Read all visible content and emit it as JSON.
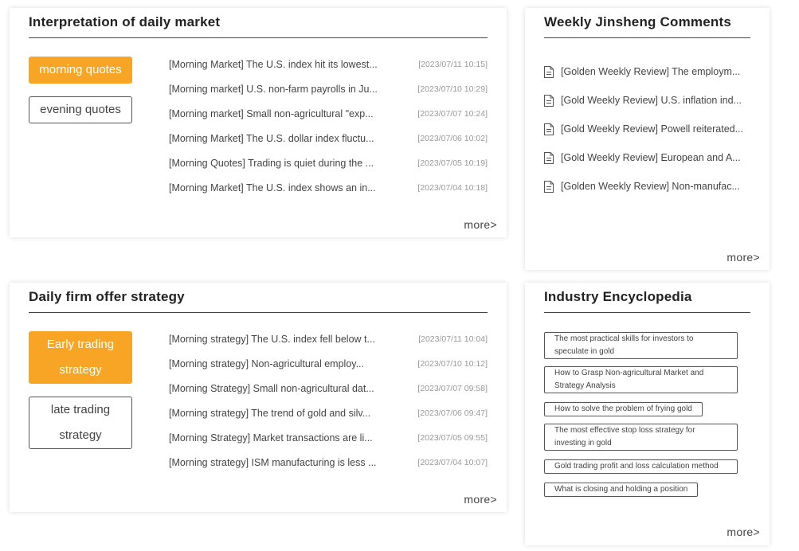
{
  "daily_market": {
    "title": "Interpretation of daily market",
    "tabs": [
      "morning quotes",
      "evening quotes"
    ],
    "items": [
      {
        "title": "[Morning Market] The U.S. index hit its lowest...",
        "date": "[2023/07/11 10:15]"
      },
      {
        "title": "[Morning market] U.S. non-farm payrolls in Ju...",
        "date": "[2023/07/10 10:29]"
      },
      {
        "title": "[Morning market] Small non-agricultural \"exp...",
        "date": "[2023/07/07 10:24]"
      },
      {
        "title": "[Morning Market] The U.S. dollar index fluctu...",
        "date": "[2023/07/06 10:02]"
      },
      {
        "title": "[Morning Quotes] Trading is quiet during the ...",
        "date": "[2023/07/05 10:19]"
      },
      {
        "title": "[Morning Market] The U.S. index shows an in...",
        "date": "[2023/07/04 10:18]"
      }
    ],
    "more": "more>"
  },
  "weekly_comments": {
    "title": "Weekly Jinsheng Comments",
    "items": [
      "[Golden Weekly Review] The employm...",
      "[Gold Weekly Review] U.S. inflation ind...",
      "[Gold Weekly Review] Powell reiterated...",
      "[Gold Weekly Review] European and A...",
      "[Golden Weekly Review] Non-manufac..."
    ],
    "icon": "document-icon",
    "more": "more>"
  },
  "firm_offer": {
    "title": "Daily firm offer strategy",
    "tabs": [
      "Early trading strategy",
      "late trading strategy"
    ],
    "items": [
      {
        "title": "[Morning strategy] The U.S. index fell below t...",
        "date": "[2023/07/11 10:04]"
      },
      {
        "title": "[Morning strategy] Non-agricultural employ...",
        "date": "[2023/07/10 10:12]"
      },
      {
        "title": "[Morning Strategy] Small non-agricultural dat...",
        "date": "[2023/07/07 09:58]"
      },
      {
        "title": "[Morning strategy] The trend of gold and silv...",
        "date": "[2023/07/06 09:47]"
      },
      {
        "title": "[Morning Strategy] Market transactions are li...",
        "date": "[2023/07/05 09:55]"
      },
      {
        "title": "[Morning strategy] ISM manufacturing is less ...",
        "date": "[2023/07/04 10:07]"
      }
    ],
    "more": "more>"
  },
  "encyclopedia": {
    "title": "Industry Encyclopedia",
    "tags": [
      "The most practical skills for investors to speculate in gold",
      "How to Grasp Non-agricultural Market and Strategy Analysis",
      "How to solve the problem of frying gold",
      "The most effective stop loss strategy for investing in gold",
      "Gold trading profit and loss calculation method",
      "What is closing and holding a position"
    ],
    "more": "more>"
  },
  "colors": {
    "accent": "#f8a526",
    "text": "#444444",
    "date": "#999999"
  }
}
